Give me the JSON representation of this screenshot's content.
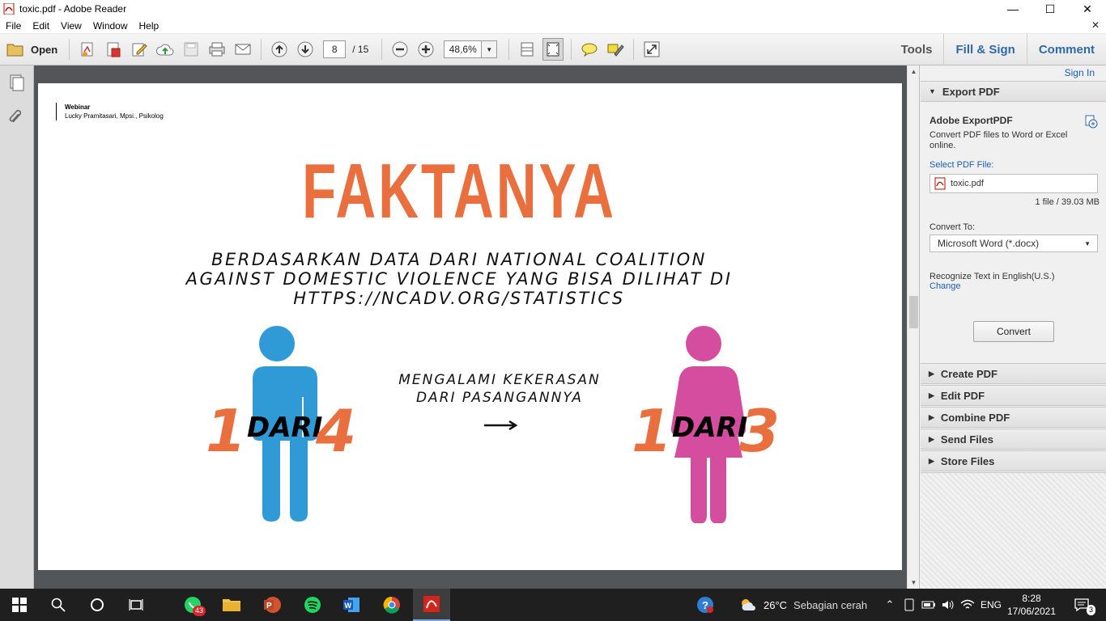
{
  "window": {
    "title": "toxic.pdf - Adobe Reader",
    "minimize": "—",
    "maximize": "☐",
    "close": "✕"
  },
  "menu": {
    "items": [
      "File",
      "Edit",
      "View",
      "Window",
      "Help"
    ],
    "close": "✕"
  },
  "toolbar": {
    "open_label": "Open",
    "page_current": "8",
    "page_total": "/ 15",
    "zoom": "48,6%",
    "tabs": [
      "Tools",
      "Fill & Sign",
      "Comment"
    ]
  },
  "document": {
    "header_line1": "Webinar",
    "header_line2": "Lucky Pramitasari, Mpsi., Psikolog",
    "headline": "FAKTANYA",
    "subtitle_line1": "BERDASARKAN DATA DARI NATIONAL COALITION",
    "subtitle_line2": "AGAINST DOMESTIC VIOLENCE  YANG BISA DILIHAT DI",
    "subtitle_line3": "HTTPS://NCADV.ORG/STATISTICS",
    "mid_line1": "MENGALAMI KEKERASAN",
    "mid_line2": "DARI PASANGANNYA",
    "male": {
      "num1": "1",
      "dari": "DARI",
      "num2": "4"
    },
    "female": {
      "num1": "1",
      "dari": "DARI",
      "num2": "3"
    },
    "colors": {
      "orange": "#ea6f3e",
      "male": "#2f9ad6",
      "female": "#d44d9e"
    }
  },
  "right_panel": {
    "sign_in": "Sign In",
    "export_pdf": "Export PDF",
    "adobe_exportpdf": "Adobe ExportPDF",
    "desc_line1": "Convert PDF files to Word or Excel",
    "desc_line2": "online.",
    "select_file_label": "Select PDF File:",
    "file_name": "toxic.pdf",
    "file_info": "1 file / 39.03 MB",
    "convert_to_label": "Convert To:",
    "convert_to_value": "Microsoft Word (*.docx)",
    "recognize_text": "Recognize Text in English(U.S.)",
    "change_link": "Change",
    "convert_button": "Convert",
    "sections": [
      "Create PDF",
      "Edit PDF",
      "Combine PDF",
      "Send Files",
      "Store Files"
    ]
  },
  "taskbar": {
    "whatsapp_badge": "43",
    "weather_temp": "26°C",
    "weather_desc": "Sebagian cerah",
    "language": "ENG",
    "time": "8:28",
    "date": "17/06/2021",
    "notification_count": "3"
  }
}
